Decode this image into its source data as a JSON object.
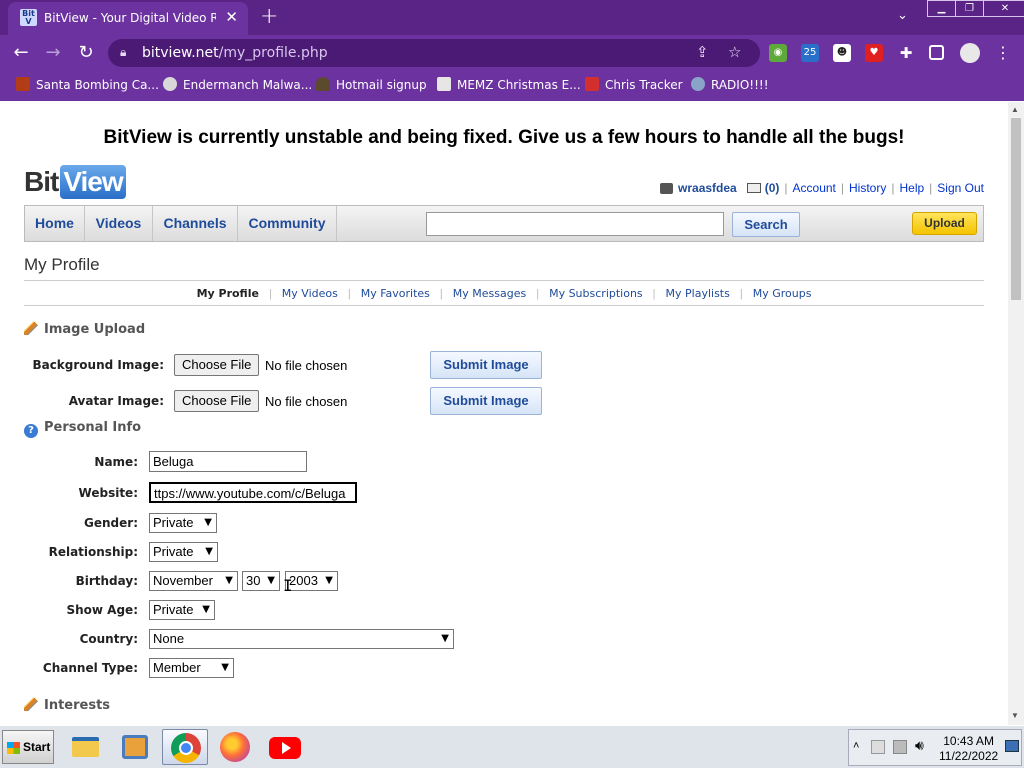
{
  "browser": {
    "tab_title": "BitView - Your Digital Video Repo",
    "tab_favicon": "BitView",
    "url_host": "bitview.net",
    "url_path": "/my_profile.php",
    "bookmarks": [
      {
        "label": "Santa Bombing Ca...",
        "icon": "skull-icon",
        "color": "#b23c17"
      },
      {
        "label": "Endermanch Malwa...",
        "icon": "enderman-icon",
        "color": "#d8d8d8"
      },
      {
        "label": "Hotmail signup",
        "icon": "person-icon",
        "color": "#5b4a2e"
      },
      {
        "label": "MEMZ Christmas E...",
        "icon": "memz-icon",
        "color": "#e6e6e6"
      },
      {
        "label": "Chris Tracker",
        "icon": "gift-icon",
        "color": "#d32f2f"
      },
      {
        "label": "RADIO!!!!",
        "icon": "radio-icon",
        "color": "#8aa4c8"
      }
    ]
  },
  "site": {
    "banner": "BitView is currently unstable and being fixed. Give us a few hours to handle all the bugs!",
    "logo_left": "Bit",
    "logo_right": "View",
    "user": {
      "username": "wraasfdea",
      "message_count": "(0)",
      "links": [
        "Account",
        "History",
        "Help",
        "Sign Out"
      ]
    },
    "nav": [
      "Home",
      "Videos",
      "Channels",
      "Community"
    ],
    "search_button": "Search",
    "upload_button": "Upload",
    "page_title": "My Profile",
    "subnav": [
      "My Profile",
      "My Videos",
      "My Favorites",
      "My Messages",
      "My Subscriptions",
      "My Playlists",
      "My Groups"
    ],
    "sections": {
      "image_upload": "Image Upload",
      "personal_info": "Personal Info",
      "interests": "Interests"
    },
    "image_upload": {
      "background_label": "Background Image:",
      "avatar_label": "Avatar Image:",
      "choose_file": "Choose File",
      "no_file": "No file chosen",
      "submit": "Submit Image"
    },
    "personal": {
      "name_label": "Name:",
      "name_value": "Beluga",
      "website_label": "Website:",
      "website_value": "ttps://www.youtube.com/c/Beluga",
      "gender_label": "Gender:",
      "gender_value": "Private",
      "relationship_label": "Relationship:",
      "relationship_value": "Private",
      "birthday_label": "Birthday:",
      "birthday_month": "November",
      "birthday_day": "30",
      "birthday_year": "2003",
      "show_age_label": "Show Age:",
      "show_age_value": "Private",
      "country_label": "Country:",
      "country_value": "None",
      "channel_type_label": "Channel Type:",
      "channel_type_value": "Member"
    }
  },
  "taskbar": {
    "start_label": "Start",
    "time": "10:43 AM",
    "date": "11/22/2022"
  }
}
